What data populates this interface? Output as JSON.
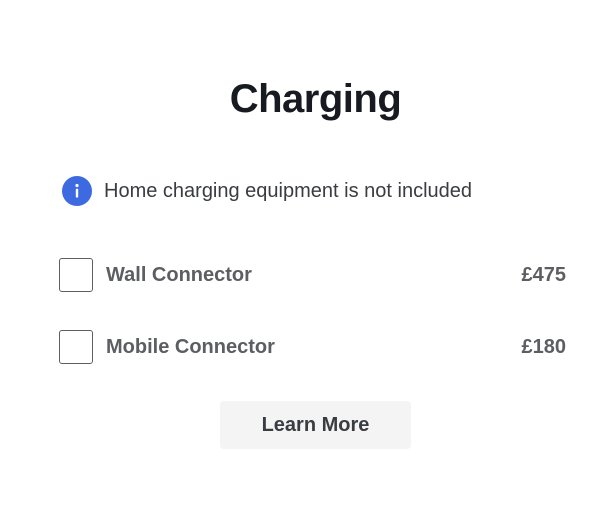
{
  "section": {
    "title": "Charging"
  },
  "notice": {
    "icon": "info-icon",
    "text": "Home charging equipment is not included",
    "icon_color": "#3e6ae1"
  },
  "options": [
    {
      "label": "Wall Connector",
      "price": "£475",
      "checked": false
    },
    {
      "label": "Mobile Connector",
      "price": "£180",
      "checked": false
    }
  ],
  "actions": {
    "learn_more_label": "Learn More"
  }
}
